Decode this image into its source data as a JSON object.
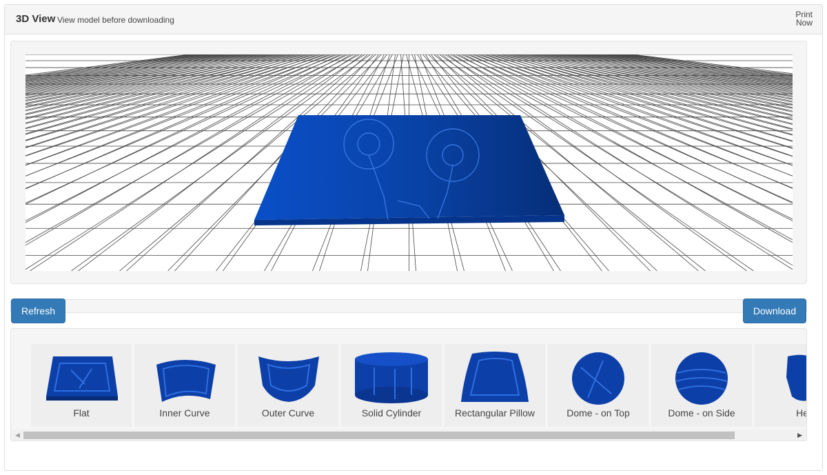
{
  "header": {
    "title": "3D View",
    "subtitle": "View model before downloading",
    "print_line1": "Print",
    "print_line2": "Now"
  },
  "toolbar": {
    "refresh_label": "Refresh",
    "download_label": "Download"
  },
  "shapes": [
    {
      "label": "Flat",
      "icon": "flat-shape-icon",
      "active": true
    },
    {
      "label": "Inner Curve",
      "icon": "inner-curve-shape-icon",
      "active": false
    },
    {
      "label": "Outer Curve",
      "icon": "outer-curve-shape-icon",
      "active": false
    },
    {
      "label": "Solid Cylinder",
      "icon": "solid-cylinder-shape-icon",
      "active": false
    },
    {
      "label": "Rectangular Pillow",
      "icon": "rectangular-pillow-shape-icon",
      "active": false
    },
    {
      "label": "Dome - on Top",
      "icon": "dome-top-shape-icon",
      "active": false
    },
    {
      "label": "Dome - on Side",
      "icon": "dome-side-shape-icon",
      "active": false
    },
    {
      "label": "Hea",
      "icon": "heart-shape-icon",
      "active": false
    }
  ],
  "colors": {
    "primary": "#337ab7",
    "model_blue": "#0b3fa0",
    "well_bg": "#f5f5f5"
  }
}
